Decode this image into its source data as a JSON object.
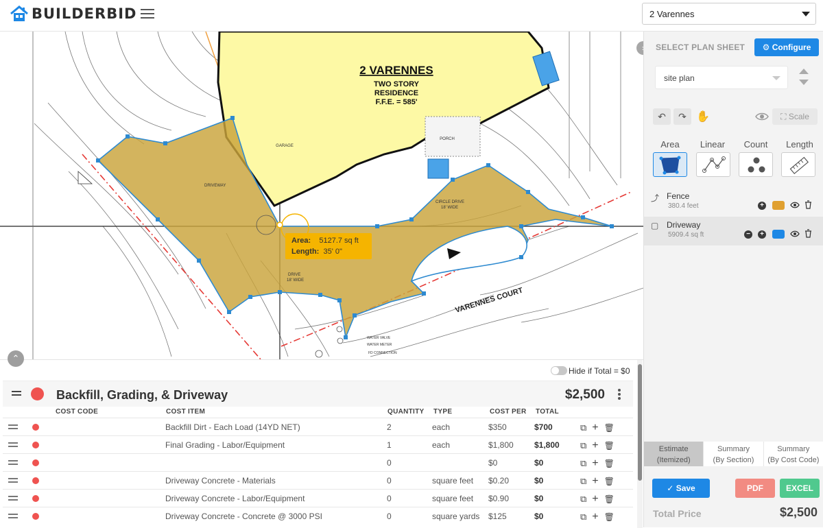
{
  "app": {
    "brand": "BUILDERBID"
  },
  "header": {
    "project": "2 Varennes"
  },
  "plan": {
    "title": "2 VARENNES",
    "subtitle_1": "TWO STORY",
    "subtitle_2": "RESIDENCE",
    "subtitle_3": "F.F.E. = 585'",
    "label_garage": "GARAGE",
    "label_porch": "PORCH",
    "label_driveway": "DRIVEWAY",
    "label_circle_drive": "CIRCLE DRIVE",
    "label_circle_drive_width": "18' WIDE",
    "label_drive": "DRIVE",
    "label_drive_width": "18' WIDE",
    "label_court": "VARENNES COURT",
    "label_water_valve": "WATER VALVE",
    "label_water_meter": "WATER METER",
    "label_fd_connection": "FD CONNECTION",
    "tooltip": {
      "area_label": "Area:",
      "area_value": "5127.7 sq ft",
      "length_label": "Length:",
      "length_value": "35' 0\""
    },
    "colors": {
      "house": "#fdf9a5",
      "driveway": "#c9a33b",
      "edge": "#2e8ad0",
      "fence": "#e53935"
    }
  },
  "right_panel": {
    "select_plan_label": "SELECT PLAN SHEET",
    "configure_label": "Configure",
    "sheet": "site plan",
    "scale_label": "Scale",
    "modes": [
      "Area",
      "Linear",
      "Count",
      "Length"
    ],
    "active_mode": "Area",
    "layers": [
      {
        "name": "Fence",
        "meta": "380.4 feet",
        "color": "#e0a030"
      },
      {
        "name": "Driveway",
        "meta": "5909.4 sq ft",
        "color": "#1e88e5"
      }
    ],
    "tabs": [
      {
        "line1": "Estimate",
        "line2": "(Itemized)"
      },
      {
        "line1": "Summary",
        "line2": "(By Section)"
      },
      {
        "line1": "Summary",
        "line2": "(By Cost Code)"
      }
    ],
    "save_label": "Save",
    "pdf_label": "PDF",
    "excel_label": "EXCEL",
    "total_label": "Total Price",
    "total_value": "$2,500"
  },
  "estimate": {
    "hide_label": "Hide if Total = $0",
    "section_title": "Backfill, Grading, & Driveway",
    "section_total": "$2,500",
    "columns": [
      "COST CODE",
      "COST ITEM",
      "QUANTITY",
      "TYPE",
      "COST PER",
      "TOTAL"
    ],
    "rows": [
      {
        "item": "Backfill Dirt - Each Load (14YD NET)",
        "qty": "2",
        "type": "each",
        "per": "$350",
        "total": "$700"
      },
      {
        "item": "Final Grading - Labor/Equipment",
        "qty": "1",
        "type": "each",
        "per": "$1,800",
        "total": "$1,800"
      },
      {
        "item": "",
        "qty": "0",
        "type": "",
        "per": "$0",
        "total": "$0"
      },
      {
        "item": "Driveway Concrete - Materials",
        "qty": "0",
        "type": "square feet",
        "per": "$0.20",
        "total": "$0"
      },
      {
        "item": "Driveway Concrete - Labor/Equipment",
        "qty": "0",
        "type": "square feet",
        "per": "$0.90",
        "total": "$0"
      },
      {
        "item": "Driveway Concrete - Concrete @ 3000 PSI",
        "qty": "0",
        "type": "square yards",
        "per": "$125",
        "total": "$0"
      }
    ]
  }
}
